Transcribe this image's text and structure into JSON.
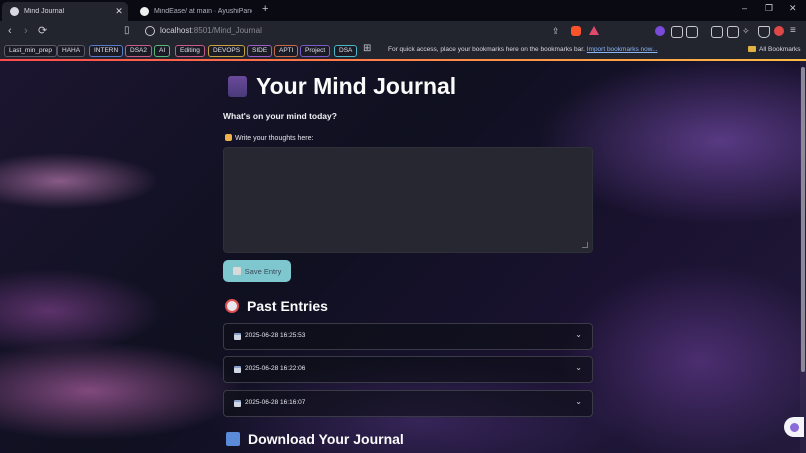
{
  "browser": {
    "tabs": [
      {
        "title": "Mind Journal",
        "active": true
      },
      {
        "title": "MindEase/ at main · AyushiPande7/I",
        "active": false
      }
    ],
    "new_tab_symbol": "+",
    "window_controls": {
      "minimize": "–",
      "restore": "❐",
      "close": "✕"
    },
    "url": {
      "host": "localhost",
      "path": ":8501/Mind_Journal"
    },
    "bookmarks": [
      "Last_min_prep",
      "HAHA",
      "INTERN",
      "DSA2",
      "AI",
      "Editing",
      "DEVOPS",
      "SIDE",
      "APTI",
      "Project",
      "DSA"
    ],
    "bookmarks_hint": "For quick access, place your bookmarks here on the bookmarks bar.",
    "import_link": "Import bookmarks now...",
    "all_bookmarks": "All Bookmarks"
  },
  "app": {
    "title": "Your Mind Journal",
    "prompt": "What's on your mind today?",
    "input_label": "Write your thoughts here:",
    "textarea_value": "",
    "save_button": "Save Entry",
    "past_entries_heading": "Past Entries",
    "entries": [
      {
        "date": "2025-06-28 16:25:53"
      },
      {
        "date": "2025-06-28 16:22:06"
      },
      {
        "date": "2025-06-28 16:16:07"
      }
    ],
    "download_heading": "Download Your Journal"
  },
  "colors": {
    "accent_button": "#7fc7cf",
    "textarea_bg": "#262730",
    "header_line_start": "#ff4b4b",
    "header_line_end": "#ffbd45"
  }
}
